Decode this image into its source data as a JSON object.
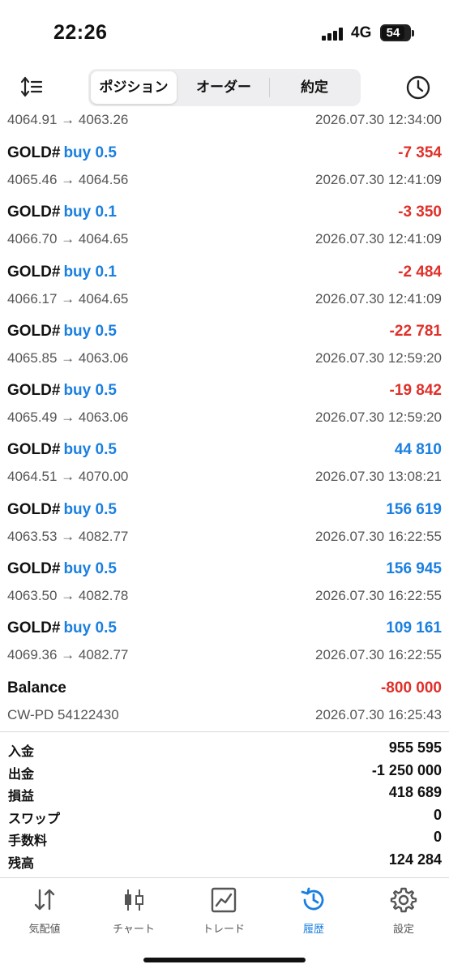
{
  "status_bar": {
    "time": "22:26",
    "network": "4G",
    "battery": "54"
  },
  "topnav": {
    "tabs": [
      {
        "label": "ポジション",
        "active": true
      },
      {
        "label": "オーダー",
        "active": false
      },
      {
        "label": "約定",
        "active": false
      }
    ],
    "sort_icon": "sort-icon",
    "history_icon": "clock-icon"
  },
  "deals": {
    "partial_first": {
      "prices": "4064.91 → 4063.26",
      "datetime": "2026.07.30 12:34:00"
    },
    "items": [
      {
        "symbol": "GOLD#",
        "side": "buy 0.5",
        "profit": "-7 354",
        "prices": "4065.46 → 4064.56",
        "datetime": "2026.07.30 12:41:09",
        "negative": true
      },
      {
        "symbol": "GOLD#",
        "side": "buy 0.1",
        "profit": "-3 350",
        "prices": "4066.70 → 4064.65",
        "datetime": "2026.07.30 12:41:09",
        "negative": true
      },
      {
        "symbol": "GOLD#",
        "side": "buy 0.1",
        "profit": "-2 484",
        "prices": "4066.17 → 4064.65",
        "datetime": "2026.07.30 12:41:09",
        "negative": true
      },
      {
        "symbol": "GOLD#",
        "side": "buy 0.5",
        "profit": "-22 781",
        "prices": "4065.85 → 4063.06",
        "datetime": "2026.07.30 12:59:20",
        "negative": true
      },
      {
        "symbol": "GOLD#",
        "side": "buy 0.5",
        "profit": "-19 842",
        "prices": "4065.49 → 4063.06",
        "datetime": "2026.07.30 12:59:20",
        "negative": true
      },
      {
        "symbol": "GOLD#",
        "side": "buy 0.5",
        "profit": "44 810",
        "prices": "4064.51 → 4070.00",
        "datetime": "2026.07.30 13:08:21",
        "negative": false
      },
      {
        "symbol": "GOLD#",
        "side": "buy 0.5",
        "profit": "156 619",
        "prices": "4063.53 → 4082.77",
        "datetime": "2026.07.30 16:22:55",
        "negative": false
      },
      {
        "symbol": "GOLD#",
        "side": "buy 0.5",
        "profit": "156 945",
        "prices": "4063.50 → 4082.78",
        "datetime": "2026.07.30 16:22:55",
        "negative": false
      },
      {
        "symbol": "GOLD#",
        "side": "buy 0.5",
        "profit": "109 161",
        "prices": "4069.36 → 4082.77",
        "datetime": "2026.07.30 16:22:55",
        "negative": false
      },
      {
        "symbol": "Balance",
        "side": "",
        "profit": "-800 000",
        "prices": "CW-PD 54122430",
        "datetime": "2026.07.30 16:25:43",
        "negative": true
      }
    ]
  },
  "summary": [
    {
      "label": "入金",
      "value": "955 595"
    },
    {
      "label": "出金",
      "value": "-1 250 000"
    },
    {
      "label": "損益",
      "value": "418 689"
    },
    {
      "label": "スワップ",
      "value": "0"
    },
    {
      "label": "手数料",
      "value": "0"
    },
    {
      "label": "残高",
      "value": "124 284"
    }
  ],
  "tabbar": [
    {
      "label": "気配値",
      "icon": "quotes-arrows-icon",
      "active": false
    },
    {
      "label": "チャート",
      "icon": "candlestick-chart-icon",
      "active": false
    },
    {
      "label": "トレード",
      "icon": "trade-chart-icon",
      "active": false
    },
    {
      "label": "履歴",
      "icon": "history-icon",
      "active": true
    },
    {
      "label": "設定",
      "icon": "gear-icon",
      "active": false
    }
  ],
  "colors": {
    "accent": "#1a7fe0",
    "negative": "#e0302a"
  }
}
